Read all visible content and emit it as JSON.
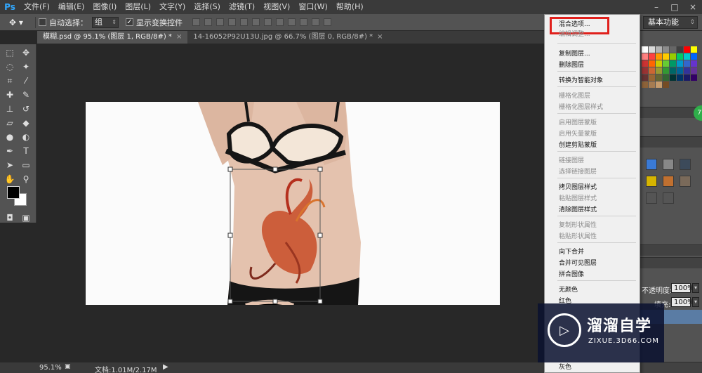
{
  "app": {
    "logo": "Ps"
  },
  "menubar": {
    "items": [
      "文件(F)",
      "编辑(E)",
      "图像(I)",
      "图层(L)",
      "文字(Y)",
      "选择(S)",
      "滤镜(T)",
      "视图(V)",
      "窗口(W)",
      "帮助(H)"
    ]
  },
  "options": {
    "auto_select_label": "自动选择：",
    "auto_select_value": "组",
    "show_transform_label": "显示变换控件",
    "show_transform_checked": true,
    "workspace": "基本功能"
  },
  "tabs": [
    {
      "label": "模糊.psd @ 95.1% (图层 1, RGB/8#) *",
      "close": "×"
    },
    {
      "label": "14-16052P92U13U.jpg @ 66.7% (图层 0, RGB/8#) *",
      "close": "×"
    }
  ],
  "context_menu": {
    "items": [
      {
        "label": "混合选项...",
        "enabled": true
      },
      {
        "label": "编辑调整...",
        "enabled": false
      },
      {
        "label": "复制图层...",
        "enabled": true
      },
      {
        "label": "删除图层",
        "enabled": true
      },
      {
        "label": "转换为智能对象",
        "enabled": true
      },
      {
        "label": "栅格化图层",
        "enabled": false
      },
      {
        "label": "栅格化图层样式",
        "enabled": false
      },
      {
        "label": "启用图层蒙版",
        "enabled": false
      },
      {
        "label": "启用矢量蒙版",
        "enabled": false
      },
      {
        "label": "创建剪贴蒙版",
        "enabled": true
      },
      {
        "label": "链接图层",
        "enabled": false
      },
      {
        "label": "选择链接图层",
        "enabled": false
      },
      {
        "label": "拷贝图层样式",
        "enabled": true
      },
      {
        "label": "粘贴图层样式",
        "enabled": false
      },
      {
        "label": "清除图层样式",
        "enabled": true
      },
      {
        "label": "复制形状属性",
        "enabled": false
      },
      {
        "label": "粘贴形状属性",
        "enabled": false
      },
      {
        "label": "向下合并",
        "enabled": true
      },
      {
        "label": "合并可见图层",
        "enabled": true
      },
      {
        "label": "拼合图像",
        "enabled": true
      },
      {
        "label": "无颜色",
        "enabled": true
      },
      {
        "label": "红色",
        "enabled": true
      },
      {
        "label": "灰色",
        "enabled": true
      }
    ]
  },
  "layers_panel": {
    "opacity_label": "不透明度:",
    "opacity_value": "100%",
    "fill_label": "填充:",
    "fill_value": "100%"
  },
  "badge": "77",
  "statusbar": {
    "zoom": "95.1%",
    "doc_info": "文档:1.01M/2.17M"
  },
  "watermark": {
    "cn": "溜溜自学",
    "en": "ZIXUE.3D66.COM"
  },
  "colors": {
    "menu_highlight": "#e0201c",
    "ps_blue": "#31a8ff"
  },
  "swatches": [
    "#ffffff",
    "#d9d9d9",
    "#b3b3b3",
    "#8c8c8c",
    "#666666",
    "#404040",
    "#ff0000",
    "#ffff00",
    "#ff8080",
    "#ff4040",
    "#ff9900",
    "#ffcc00",
    "#99cc00",
    "#00cc66",
    "#00cccc",
    "#0066ff",
    "#cc3333",
    "#ff6600",
    "#cccc00",
    "#66cc33",
    "#009966",
    "#0099cc",
    "#3366cc",
    "#6633cc",
    "#993333",
    "#cc6633",
    "#999933",
    "#339933",
    "#006666",
    "#006699",
    "#333399",
    "#663399",
    "#663333",
    "#996633",
    "#666633",
    "#336633",
    "#003333",
    "#003366",
    "#1a1a66",
    "#330066",
    "#8c6239",
    "#a67c52",
    "#c69c6d",
    "#754c24"
  ]
}
